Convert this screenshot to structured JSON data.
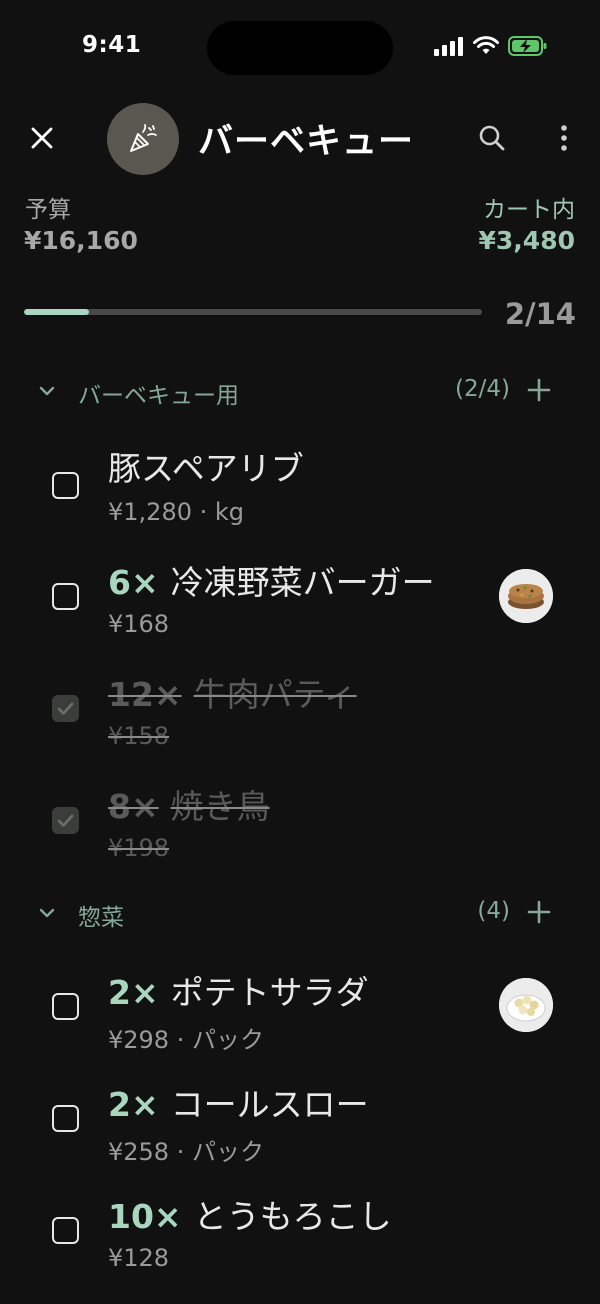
{
  "status_bar": {
    "time": "9:41"
  },
  "header": {
    "title": "バーベキュー"
  },
  "budget": {
    "budget_label": "予算",
    "budget_value": "¥16,160",
    "cart_label": "カート内",
    "cart_value": "¥3,480"
  },
  "progress": {
    "text": "2/14",
    "done": 2,
    "total": 14
  },
  "sections": [
    {
      "title": "バーベキュー用",
      "count": "(2/4)",
      "items": [
        {
          "qty": "",
          "name": "豚スペアリブ",
          "sub": "¥1,280 · kg",
          "checked": false
        },
        {
          "qty": "6×",
          "name": "冷凍野菜バーガー",
          "sub": "¥168",
          "checked": false,
          "thumbnail": "veggie-burger"
        },
        {
          "qty": "12×",
          "name": "牛肉パティ",
          "sub": "¥158",
          "checked": true
        },
        {
          "qty": "8×",
          "name": "焼き鳥",
          "sub": "¥198",
          "checked": true
        }
      ]
    },
    {
      "title": "惣菜",
      "count": "(4)",
      "items": [
        {
          "qty": "2×",
          "name": "ポテトサラダ",
          "sub": "¥298 · パック",
          "checked": false,
          "thumbnail": "potato-salad"
        },
        {
          "qty": "2×",
          "name": "コールスロー",
          "sub": "¥258 · パック",
          "checked": false
        },
        {
          "qty": "10×",
          "name": "とうもろこし",
          "sub": "¥128",
          "checked": false
        }
      ]
    }
  ],
  "colors": {
    "background": "#111111",
    "accent": "#a9d6be",
    "muted_accent": "#86a898"
  }
}
